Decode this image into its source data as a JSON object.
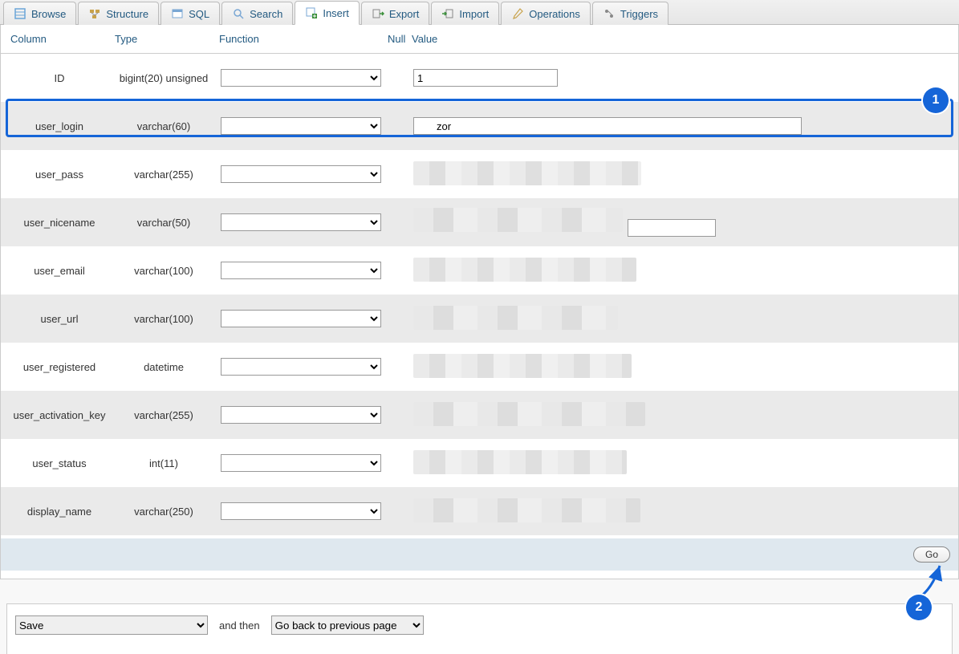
{
  "tabs": [
    {
      "label": "Browse"
    },
    {
      "label": "Structure"
    },
    {
      "label": "SQL"
    },
    {
      "label": "Search"
    },
    {
      "label": "Insert"
    },
    {
      "label": "Export"
    },
    {
      "label": "Import"
    },
    {
      "label": "Operations"
    },
    {
      "label": "Triggers"
    }
  ],
  "active_tab": "Insert",
  "headers": {
    "column": "Column",
    "type": "Type",
    "function": "Function",
    "null": "Null",
    "value": "Value"
  },
  "rows": [
    {
      "name": "ID",
      "type": "bigint(20) unsigned",
      "value": "1",
      "alt": false,
      "obscured": false,
      "short": true
    },
    {
      "name": "user_login",
      "type": "varchar(60)",
      "value": "zor",
      "alt": true,
      "obscured": false,
      "short": false,
      "highlighted": true
    },
    {
      "name": "user_pass",
      "type": "varchar(255)",
      "value": "",
      "alt": false,
      "obscured": true
    },
    {
      "name": "user_nicename",
      "type": "varchar(50)",
      "value": "",
      "alt": true,
      "obscured": true
    },
    {
      "name": "user_email",
      "type": "varchar(100)",
      "value": "",
      "alt": false,
      "obscured": true
    },
    {
      "name": "user_url",
      "type": "varchar(100)",
      "value": "",
      "alt": true,
      "obscured": true
    },
    {
      "name": "user_registered",
      "type": "datetime",
      "value": "",
      "alt": false,
      "obscured": true
    },
    {
      "name": "user_activation_key",
      "type": "varchar(255)",
      "value": "",
      "alt": true,
      "obscured": true
    },
    {
      "name": "user_status",
      "type": "int(11)",
      "value": "",
      "alt": false,
      "obscured": true
    },
    {
      "name": "display_name",
      "type": "varchar(250)",
      "value": "",
      "alt": true,
      "obscured": true
    }
  ],
  "go_label": "Go",
  "footer": {
    "save_select": "Save",
    "and_then": "and then",
    "after_select": "Go back to previous page"
  },
  "annotations": {
    "one": "1",
    "two": "2"
  }
}
